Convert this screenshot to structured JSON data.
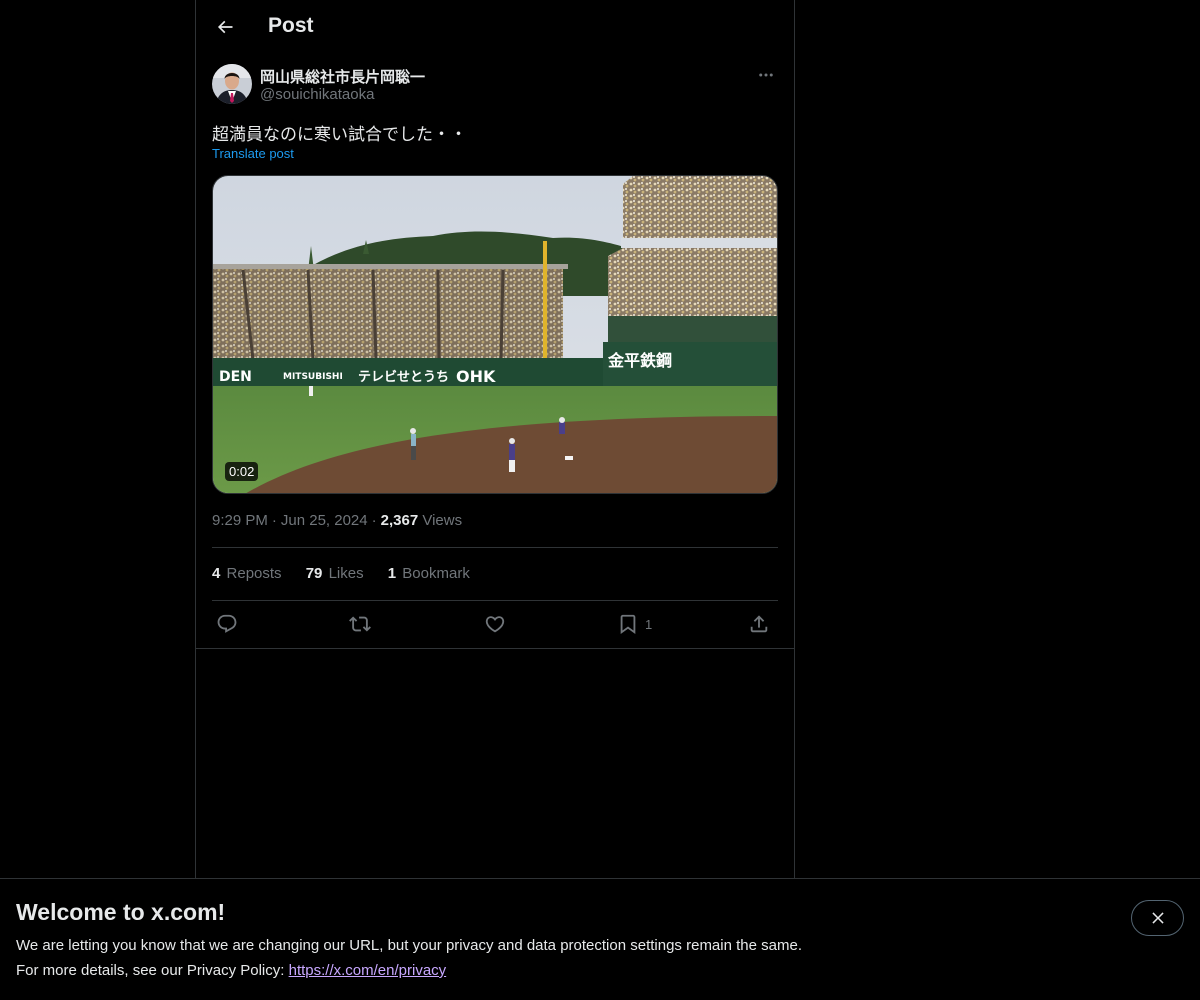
{
  "header": {
    "title": "Post",
    "back_icon": "arrow-left-icon"
  },
  "post": {
    "author": {
      "display_name": "岡山県総社市長片岡聡一",
      "handle": "@souichikataoka"
    },
    "text": "超満員なのに寒い試合でした・・",
    "translate_label": "Translate post",
    "media": {
      "type": "video",
      "duration": "0:02"
    },
    "time": "9:29 PM",
    "date": "Jun 25, 2024",
    "views_count": "2,367",
    "views_label": "Views",
    "stats": {
      "reposts_count": "4",
      "reposts_label": "Reposts",
      "likes_count": "79",
      "likes_label": "Likes",
      "bookmarks_count": "1",
      "bookmarks_label": "Bookmark"
    },
    "actions": {
      "bookmark_count": "1",
      "icons": [
        "reply-icon",
        "repost-icon",
        "like-icon",
        "bookmark-icon",
        "share-icon"
      ]
    }
  },
  "banner": {
    "title": "Welcome to x.com!",
    "line1": "We are letting you know that we are changing our URL, but your privacy and data protection settings remain the same.",
    "line2_prefix": "For more details, see our Privacy Policy:",
    "link": "https://x.com/en/privacy"
  },
  "colors": {
    "background": "#000000",
    "text_primary": "#e7e9ea",
    "text_secondary": "#71767b",
    "accent": "#1d9bf0",
    "border": "#2f3336",
    "link_visited": "#c8a8ff"
  }
}
